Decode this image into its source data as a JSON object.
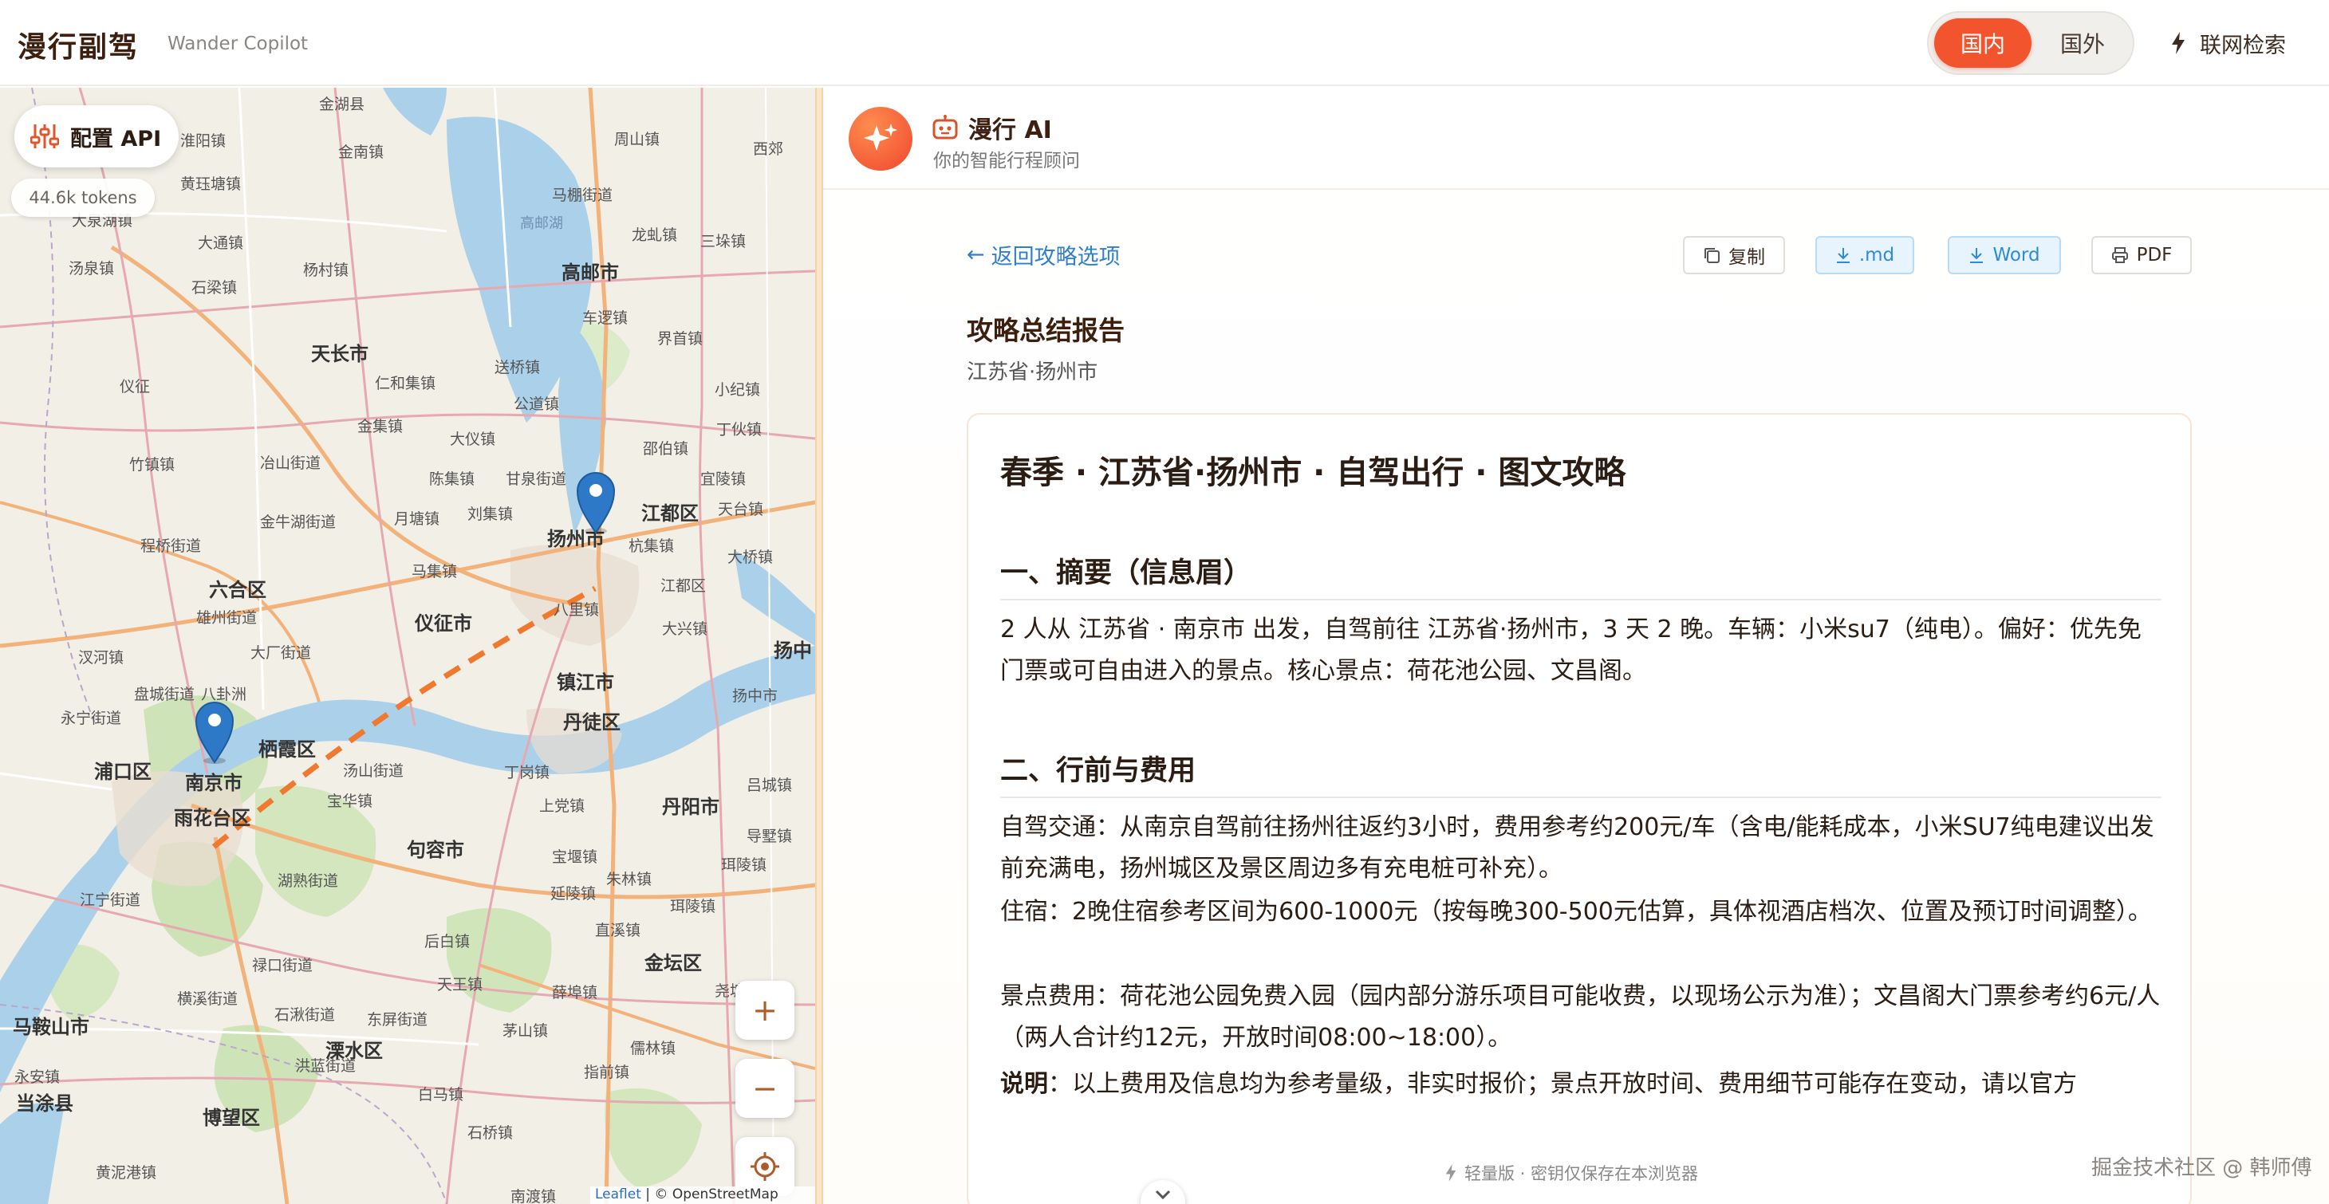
{
  "header": {
    "title": "漫行副驾",
    "subtitle": "Wander Copilot",
    "region_domestic": "国内",
    "region_abroad": "国外",
    "web_search": "联网检索"
  },
  "map": {
    "api_button": "配置 API",
    "tokens": "44.6k tokens",
    "zoom_in": "+",
    "zoom_out": "−",
    "attribution_leaflet": "Leaflet",
    "attribution_osm": "| © OpenStreetMap",
    "labels": {
      "l1": "金湖县",
      "l2": "淮阳镇",
      "l3": "周山镇",
      "l4": "西郊",
      "l5": "金南镇",
      "l6": "黄珏塘镇",
      "l7": "马棚街道",
      "l8": "高邮湖",
      "l9": "龙虬镇",
      "l10": "三垛镇",
      "l11": "大通镇",
      "l12": "石梁镇",
      "l13": "杨村镇",
      "l14": "高邮市",
      "l15": "车逻镇",
      "l16": "天长市",
      "l17": "仁和集镇",
      "l18": "送桥镇",
      "l19": "界首镇",
      "l20": "公道镇",
      "l21": "汤泉镇",
      "l22": "金集镇",
      "l23": "大仪镇",
      "l24": "甘泉街道",
      "l25": "扬州市",
      "l26": "江都区",
      "l27": "仪征市",
      "l28": "六合区",
      "l29": "八里镇",
      "l30": "杭集镇",
      "l31": "大桥镇",
      "l32": "南京市",
      "l33": "栖霞区",
      "l34": "镇江市",
      "l35": "丹徒区",
      "l36": "扬中",
      "l37": "浦口区",
      "l38": "雨花台区",
      "l39": "句容市",
      "l40": "丹阳市",
      "l41": "江宁街道",
      "l42": "天王镇",
      "l43": "马鞍山市",
      "l44": "当涂县",
      "l45": "溧水区",
      "l46": "博望区",
      "l47": "白马镇",
      "l48": "金坛区",
      "l49": "薛埠镇",
      "l50": "大泉湖镇",
      "l51": "永宁街道",
      "l52": "天台镇",
      "l53": "江都区",
      "l54": "扬中市",
      "l55": "珥陵镇",
      "l56": "仪征",
      "l57": "陈集镇",
      "l58": "月塘镇",
      "l59": "刘集镇",
      "l60": "马集镇",
      "l61": "程桥街道",
      "l62": "汊河镇",
      "l63": "八卦洲",
      "l64": "宝华镇",
      "l65": "汤山街道",
      "l66": "湖熟街道",
      "l67": "禄口街道",
      "l68": "横溪街道",
      "l69": "石湫街道",
      "l70": "东屏街道",
      "l71": "洪蓝街道",
      "l72": "后白镇",
      "l73": "延陵镇",
      "l74": "丁岗镇",
      "l75": "上党镇",
      "l76": "宝堰镇",
      "l77": "珥陵镇",
      "l78": "吕城镇",
      "l79": "导墅镇",
      "l80": "直溪镇",
      "l81": "朱林镇",
      "l82": "茅山镇",
      "l83": "指前镇",
      "l84": "儒林镇",
      "l85": "尧塘镇",
      "l86": "石桥镇",
      "l87": "南渡镇",
      "l88": "邵伯镇",
      "l89": "丁伙镇",
      "l90": "小纪镇",
      "l91": "宜陵镇",
      "l92": "大兴镇",
      "l93": "竹镇镇",
      "l94": "冶山街道",
      "l95": "金牛湖街道",
      "l96": "雄州街道",
      "l97": "大厂街道",
      "l98": "盘城街道",
      "l99": "永安镇",
      "l100": "黄泥港镇"
    }
  },
  "assistant": {
    "name": "漫行 AI",
    "tagline": "你的智能行程顾问"
  },
  "report": {
    "back": "返回攻略选项",
    "copy": "复制",
    "md": ".md",
    "word": "Word",
    "pdf": "PDF",
    "title": "攻略总结报告",
    "location": "江苏省·扬州市",
    "doc_title": "春季 · 江苏省·扬州市 · 自驾出行 · 图文攻略",
    "section1": "一、摘要（信息眉）",
    "summary": "2 人从 江苏省 · 南京市 出发，自驾前往 江苏省·扬州市，3 天 2 晚。车辆：小米su7（纯电）。偏好：优先免门票或可自由进入的景点。核心景点：荷花池公园、文昌阁。",
    "section2": "二、行前与费用",
    "traffic": "自驾交通：从南京自驾前往扬州往返约3小时，费用参考约200元/车（含电/能耗成本，小米SU7纯电建议出发前充满电，扬州城区及景区周边多有充电桩可补充）。",
    "lodging": "住宿：2晚住宿参考区间为600-1000元（按每晚300-500元估算，具体视酒店档次、位置及预订时间调整）。",
    "tickets": "景点费用：荷花池公园免费入园（园内部分游乐项目可能收费，以现场公示为准）；文昌阁大门票参考约6元/人（两人合计约12元，开放时间08:00~18:00）。",
    "note_label": "说明",
    "note_text": "：以上费用及信息均为参考量级，非实时报价；景点开放时间、费用细节可能存在变动，请以官方"
  },
  "footer": {
    "note": "轻量版 · 密钥仅保存在本浏览器",
    "watermark": "掘金技术社区 @ 韩师傅"
  },
  "colors": {
    "accent": "#f2542d",
    "link": "#2f7fd0",
    "route": "#ef7a2f",
    "marker": "#2d79c7"
  },
  "icons": {
    "api": "sliders-icon",
    "search": "bolt-icon",
    "avatar": "sparkle-icon",
    "robot": "robot-icon",
    "copy": "copy-icon",
    "download": "download-icon",
    "print": "printer-icon",
    "locate": "crosshair-icon",
    "chevron": "chevron-down-icon"
  }
}
